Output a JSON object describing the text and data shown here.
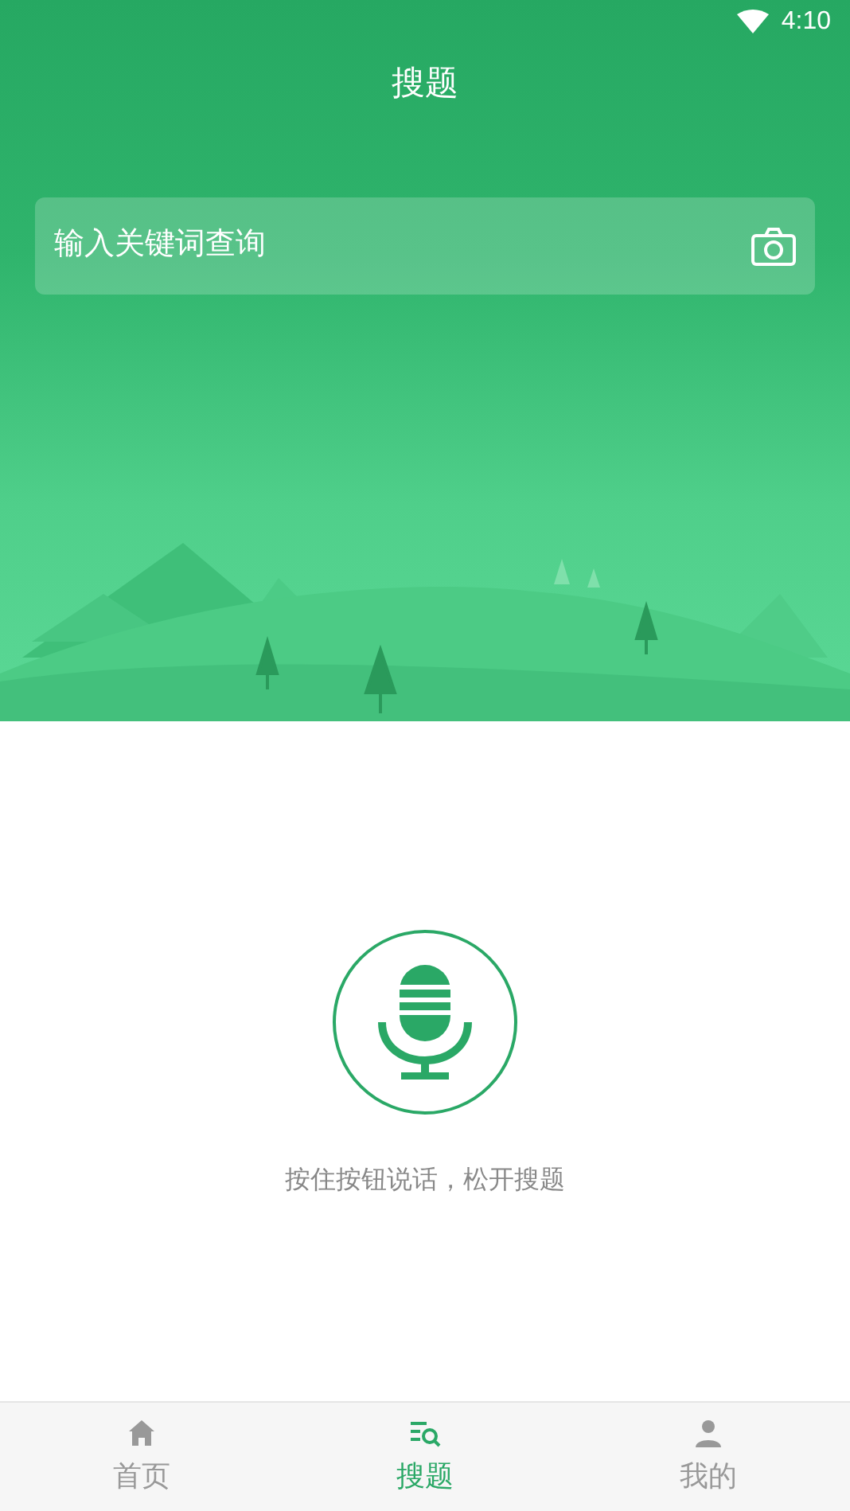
{
  "status_bar": {
    "time": "4:10"
  },
  "header": {
    "title": "搜题"
  },
  "search": {
    "placeholder": "输入关键词查询"
  },
  "voice": {
    "hint": "按住按钮说话，松开搜题"
  },
  "tabs": [
    {
      "label": "首页",
      "kind": "home",
      "selected": false
    },
    {
      "label": "搜题",
      "kind": "search",
      "selected": true
    },
    {
      "label": "我的",
      "kind": "person",
      "selected": false
    }
  ]
}
